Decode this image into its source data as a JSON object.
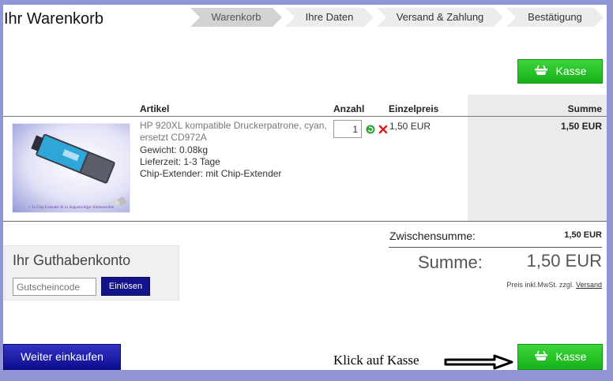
{
  "page": {
    "title": "Ihr Warenkorb"
  },
  "steps": [
    {
      "label": "Warenkorb",
      "active": true
    },
    {
      "label": "Ihre Daten",
      "active": false
    },
    {
      "label": "Versand & Zahlung",
      "active": false
    },
    {
      "label": "Bestätigung",
      "active": false
    }
  ],
  "checkout": {
    "label": "Kasse"
  },
  "table": {
    "headers": {
      "article": "Artikel",
      "quantity": "Anzahl",
      "unit_price": "Einzelpreis",
      "sum": "Summe"
    }
  },
  "item": {
    "name": "HP 920XL kompatible Druckerpatrone, cyan, ersetzt CD972A",
    "weight": "Gewicht: 0.08kg",
    "delivery": "Lieferzeit: 1-3 Tage",
    "option": "Chip-Extender: mit Chip-Extender",
    "quantity": "1",
    "unit_price": "1,50 EUR",
    "total": "1,50 EUR",
    "image_caption": "+ 1x Chip Extender & 1x doppelseitiger Klebestreifen",
    "icons": {
      "refresh": "refresh-icon",
      "delete": "delete-icon"
    },
    "colors": {
      "refresh": "#2e9e2e",
      "delete": "#e02020"
    }
  },
  "credit": {
    "title": "Ihr Guthabenkonto",
    "voucher_placeholder": "Gutscheincode",
    "redeem_label": "Einlösen"
  },
  "totals": {
    "subtotal_label": "Zwischensumme:",
    "subtotal_value": "1,50 EUR",
    "total_label": "Summe:",
    "total_value": "1,50 EUR",
    "tax_note": "Preis inkl.MwSt. zzgl.",
    "shipping_link": "Versand"
  },
  "footer": {
    "continue_label": "Weiter einkaufen",
    "annotation": "Klick auf Kasse"
  },
  "colors": {
    "accent_green": "#22bb22",
    "accent_blue": "#13138a",
    "background": "#8f95d6"
  }
}
